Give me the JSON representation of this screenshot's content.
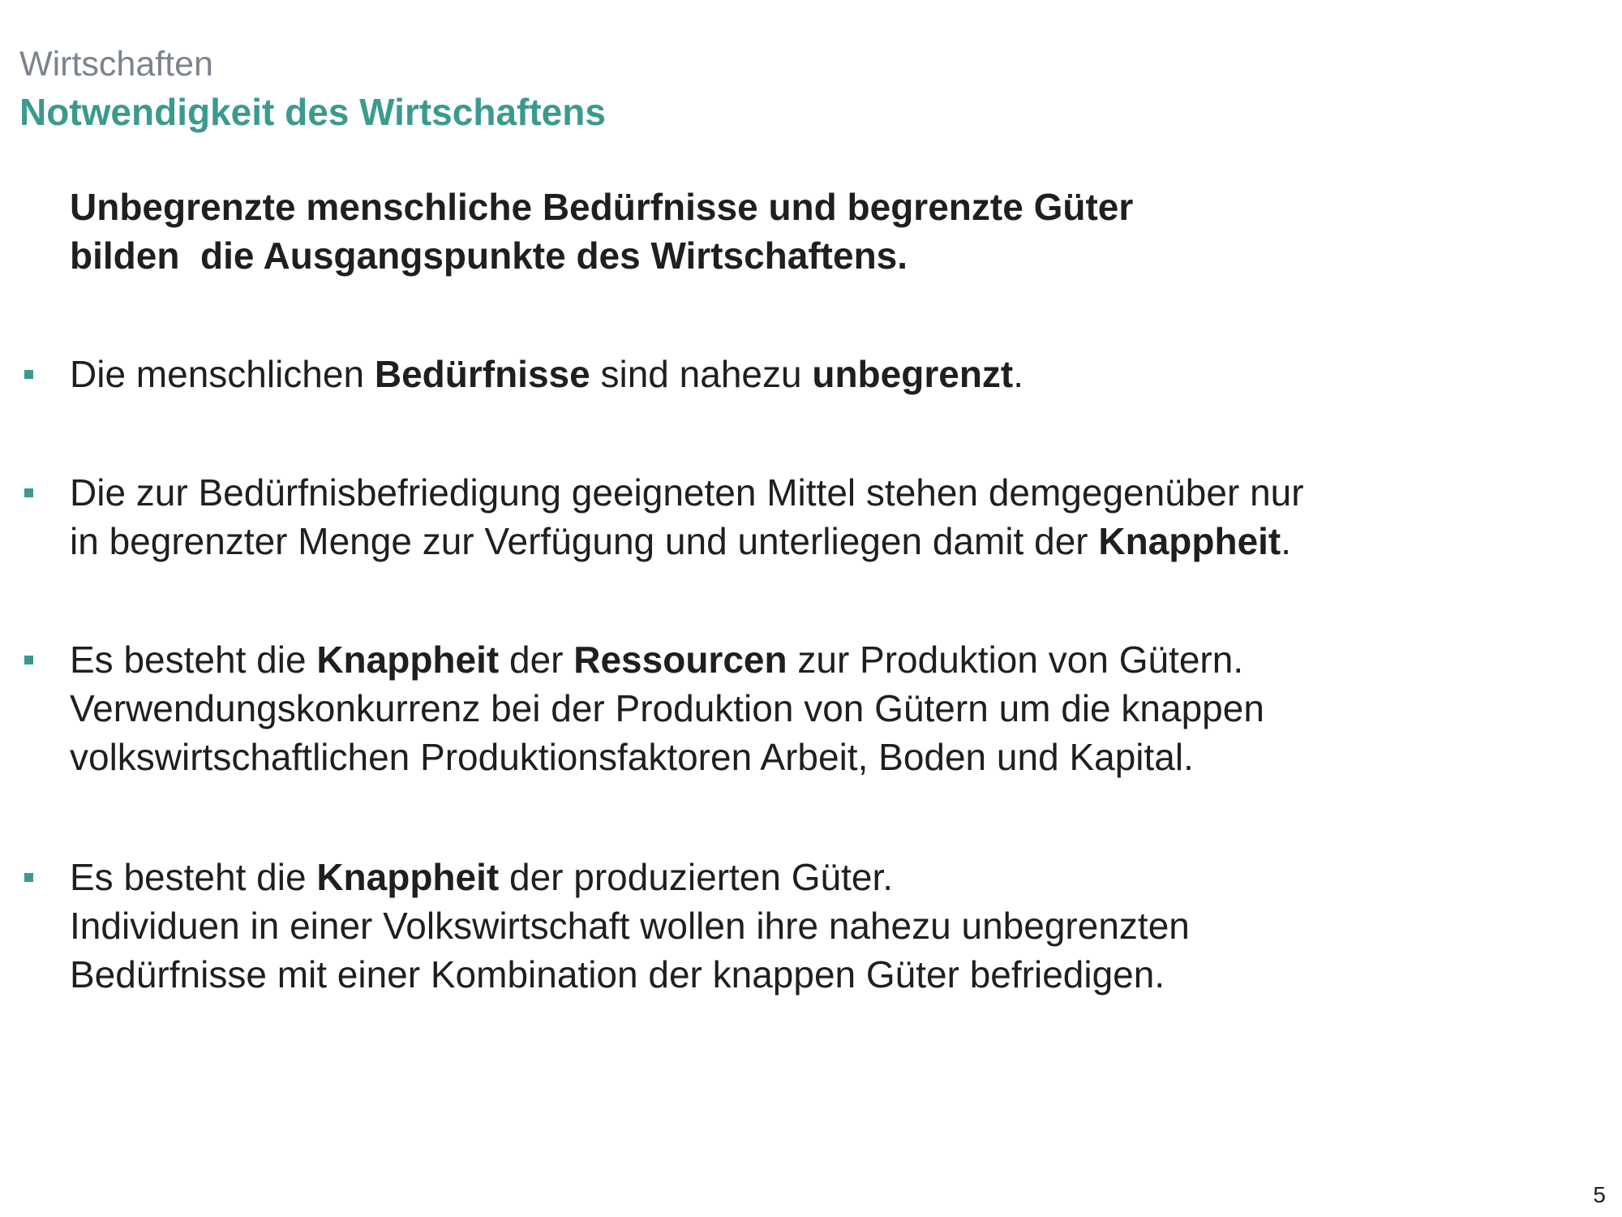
{
  "header": {
    "kicker": "Wirtschaften",
    "title": "Notwendigkeit des Wirtschaftens"
  },
  "lead": {
    "line1": "Unbegrenzte menschliche Bedürfnisse und begrenzte Güter",
    "line2": "bilden  die Ausgangspunkte des Wirtschaftens."
  },
  "bullets": [
    {
      "lines": [
        [
          {
            "text": "Die menschlichen ",
            "bold": false
          },
          {
            "text": "Bedürfnisse",
            "bold": true
          },
          {
            "text": " sind nahezu ",
            "bold": false
          },
          {
            "text": "unbegrenzt",
            "bold": true
          },
          {
            "text": ".",
            "bold": false
          }
        ]
      ]
    },
    {
      "lines": [
        [
          {
            "text": "Die zur Bedürfnisbefriedigung geeigneten Mittel stehen demgegenüber nur",
            "bold": false
          }
        ],
        [
          {
            "text": "in begrenzter Menge zur Verfügung und unterliegen damit der ",
            "bold": false
          },
          {
            "text": "Knappheit",
            "bold": true
          },
          {
            "text": ".",
            "bold": false
          }
        ]
      ]
    },
    {
      "lines": [
        [
          {
            "text": "Es besteht die ",
            "bold": false
          },
          {
            "text": "Knappheit",
            "bold": true
          },
          {
            "text": " der ",
            "bold": false
          },
          {
            "text": "Ressourcen",
            "bold": true
          },
          {
            "text": " zur Produktion von Gütern.",
            "bold": false
          }
        ],
        [
          {
            "text": "Verwendungskonkurrenz bei der Produktion von Gütern um die knappen",
            "bold": false
          }
        ],
        [
          {
            "text": "volkswirtschaftlichen Produktionsfaktoren Arbeit, Boden und Kapital.",
            "bold": false
          }
        ]
      ]
    },
    {
      "lines": [
        [
          {
            "text": "Es besteht die ",
            "bold": false
          },
          {
            "text": "Knappheit",
            "bold": true
          },
          {
            "text": " der produzierten Güter.",
            "bold": false
          }
        ],
        [
          {
            "text": "Individuen in einer Volkswirtschaft wollen ihre nahezu unbegrenzten",
            "bold": false
          }
        ],
        [
          {
            "text": "Bedürfnisse mit einer Kombination der knappen Güter befriedigen.",
            "bold": false
          }
        ]
      ]
    }
  ],
  "footer": {
    "page_number": "5"
  },
  "colors": {
    "accent": "#3a9a8e",
    "kicker": "#7c838c",
    "text": "#1f1f1f"
  }
}
